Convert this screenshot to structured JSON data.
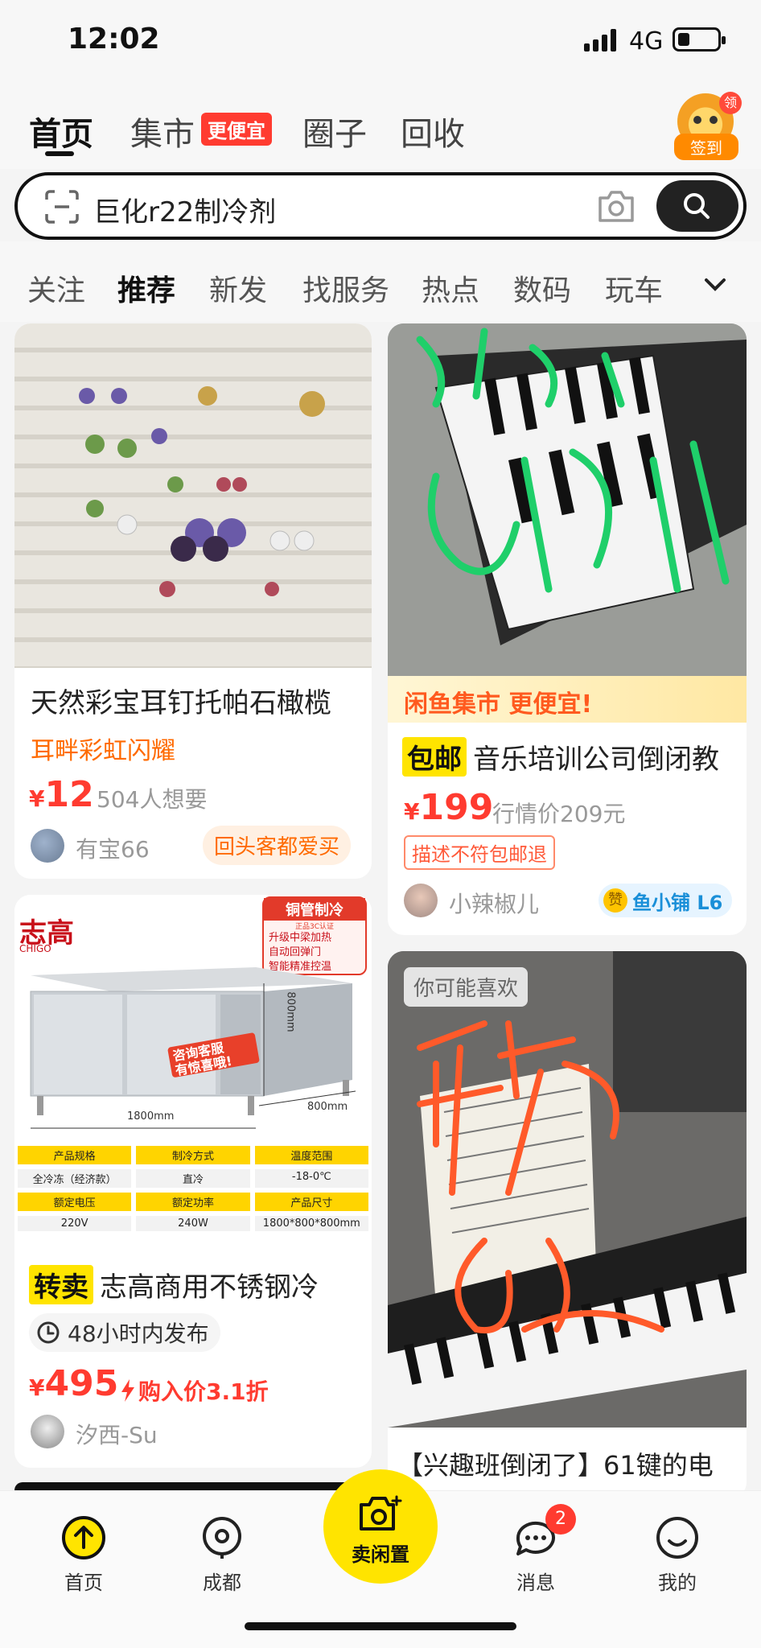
{
  "status": {
    "time": "12:02",
    "network": "4G"
  },
  "topnav": {
    "tabs": [
      "首页",
      "集市",
      "圈子",
      "回收"
    ],
    "market_badge": "更便宜",
    "sign_in_label": "签到",
    "sign_in_badge": "领"
  },
  "search": {
    "value": "巨化r22制冷剂"
  },
  "categories": [
    "关注",
    "推荐",
    "新发",
    "找服务",
    "热点",
    "数码",
    "玩车"
  ],
  "feed": {
    "card1": {
      "title": "天然彩宝耳钉托帕石橄榄",
      "subtitle": "耳畔彩虹闪耀",
      "price_symbol": "¥",
      "price": "12",
      "wants": "504人想要",
      "seller": "有宝66",
      "badge": "回头客都爱买"
    },
    "card2": {
      "banner": "闲鱼集市 更便宜!",
      "tag": "包邮",
      "title": "音乐培训公司倒闭教",
      "price_symbol": "¥",
      "price": "199",
      "market_price": "行情价209元",
      "guarantee": "描述不符包邮退",
      "seller": "小辣椒儿",
      "shop_badge_icon": "赞",
      "shop_badge": "鱼小铺 L6"
    },
    "card3": {
      "ad_brand": "志高",
      "ad_brand_en": "CHIGO",
      "ad_panel_title": "铜管制冷",
      "ad_panel_sub": "正品3C认证",
      "ad_features": [
        "升级中梁加热",
        "自动回弹门",
        "智能精准控温"
      ],
      "ad_bubble": [
        "咨询客服",
        "有惊喜哦!"
      ],
      "dims": [
        "1800mm",
        "800mm",
        "800mm"
      ],
      "spec_headers": [
        "产品规格",
        "制冷方式",
        "温度范围",
        "额定电压",
        "额定功率",
        "产品尺寸"
      ],
      "spec_values": [
        "全冷冻（经济款）",
        "直冷",
        "-18-0℃",
        "220V",
        "240W",
        "1800*800*800mm"
      ],
      "tag": "转卖",
      "title": "志高商用不锈钢冷",
      "time_label": "48小时内发布",
      "price_symbol": "¥",
      "price": "495",
      "discount": "购入价3.1折",
      "seller": "汐西-Su"
    },
    "card4": {
      "overlay": "你可能喜欢",
      "title": "【兴趣班倒闭了】61键的电"
    }
  },
  "bottombar": {
    "items": [
      "首页",
      "成都",
      "卖闲置",
      "消息",
      "我的"
    ],
    "message_count": "2"
  },
  "colors": {
    "accent_yellow": "#ffe400",
    "price_red": "#ff3b30",
    "orange": "#ff6a00"
  }
}
